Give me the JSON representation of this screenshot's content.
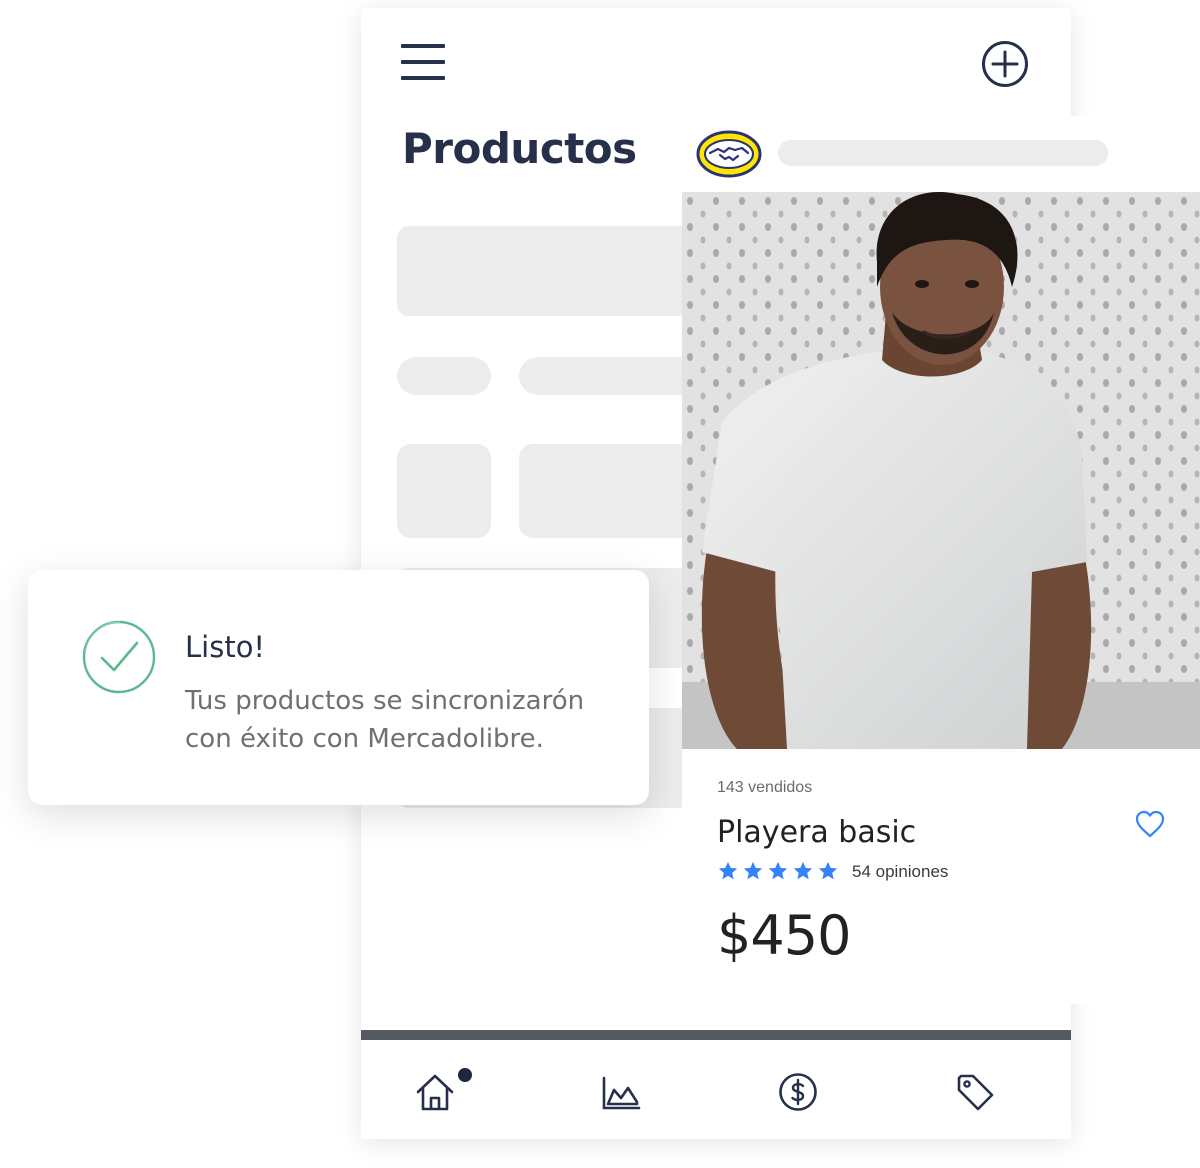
{
  "app": {
    "page_title": "Productos",
    "icons": {
      "menu": "hamburger-menu-icon",
      "add": "plus-circle-icon"
    }
  },
  "bottom_nav": {
    "items": [
      {
        "name": "home",
        "icon": "home-icon",
        "active": true
      },
      {
        "name": "analytics",
        "icon": "chart-icon",
        "active": false
      },
      {
        "name": "payments",
        "icon": "dollar-circle-icon",
        "active": false
      },
      {
        "name": "products",
        "icon": "tag-icon",
        "active": false
      }
    ],
    "notification_dot_color": "#1f2740"
  },
  "product_card": {
    "marketplace_logo": "mercadolibre-handshake-logo",
    "sold_text": "143 vendidos",
    "name": "Playera basic",
    "rating": 5,
    "rating_max": 5,
    "reviews_text": "54 opiniones",
    "price": "$450",
    "star_color": "#3483fa",
    "heart_icon": "heart-outline-icon"
  },
  "toast": {
    "icon": "check-circle-icon",
    "title": "Listo!",
    "message": "Tus productos se sincronizarón con éxito con Mercadolibre.",
    "check_color": "#5cb88f"
  },
  "colors": {
    "title_text": "#27304a",
    "skeleton": "#ececec",
    "nav_divider": "#555a60"
  }
}
